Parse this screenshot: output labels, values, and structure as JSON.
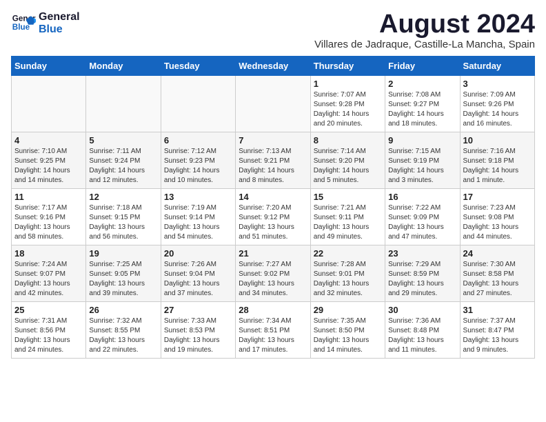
{
  "logo": {
    "line1": "General",
    "line2": "Blue"
  },
  "title": "August 2024",
  "location": "Villares de Jadraque, Castille-La Mancha, Spain",
  "weekdays": [
    "Sunday",
    "Monday",
    "Tuesday",
    "Wednesday",
    "Thursday",
    "Friday",
    "Saturday"
  ],
  "weeks": [
    [
      {
        "day": "",
        "info": ""
      },
      {
        "day": "",
        "info": ""
      },
      {
        "day": "",
        "info": ""
      },
      {
        "day": "",
        "info": ""
      },
      {
        "day": "1",
        "info": "Sunrise: 7:07 AM\nSunset: 9:28 PM\nDaylight: 14 hours\nand 20 minutes."
      },
      {
        "day": "2",
        "info": "Sunrise: 7:08 AM\nSunset: 9:27 PM\nDaylight: 14 hours\nand 18 minutes."
      },
      {
        "day": "3",
        "info": "Sunrise: 7:09 AM\nSunset: 9:26 PM\nDaylight: 14 hours\nand 16 minutes."
      }
    ],
    [
      {
        "day": "4",
        "info": "Sunrise: 7:10 AM\nSunset: 9:25 PM\nDaylight: 14 hours\nand 14 minutes."
      },
      {
        "day": "5",
        "info": "Sunrise: 7:11 AM\nSunset: 9:24 PM\nDaylight: 14 hours\nand 12 minutes."
      },
      {
        "day": "6",
        "info": "Sunrise: 7:12 AM\nSunset: 9:23 PM\nDaylight: 14 hours\nand 10 minutes."
      },
      {
        "day": "7",
        "info": "Sunrise: 7:13 AM\nSunset: 9:21 PM\nDaylight: 14 hours\nand 8 minutes."
      },
      {
        "day": "8",
        "info": "Sunrise: 7:14 AM\nSunset: 9:20 PM\nDaylight: 14 hours\nand 5 minutes."
      },
      {
        "day": "9",
        "info": "Sunrise: 7:15 AM\nSunset: 9:19 PM\nDaylight: 14 hours\nand 3 minutes."
      },
      {
        "day": "10",
        "info": "Sunrise: 7:16 AM\nSunset: 9:18 PM\nDaylight: 14 hours\nand 1 minute."
      }
    ],
    [
      {
        "day": "11",
        "info": "Sunrise: 7:17 AM\nSunset: 9:16 PM\nDaylight: 13 hours\nand 58 minutes."
      },
      {
        "day": "12",
        "info": "Sunrise: 7:18 AM\nSunset: 9:15 PM\nDaylight: 13 hours\nand 56 minutes."
      },
      {
        "day": "13",
        "info": "Sunrise: 7:19 AM\nSunset: 9:14 PM\nDaylight: 13 hours\nand 54 minutes."
      },
      {
        "day": "14",
        "info": "Sunrise: 7:20 AM\nSunset: 9:12 PM\nDaylight: 13 hours\nand 51 minutes."
      },
      {
        "day": "15",
        "info": "Sunrise: 7:21 AM\nSunset: 9:11 PM\nDaylight: 13 hours\nand 49 minutes."
      },
      {
        "day": "16",
        "info": "Sunrise: 7:22 AM\nSunset: 9:09 PM\nDaylight: 13 hours\nand 47 minutes."
      },
      {
        "day": "17",
        "info": "Sunrise: 7:23 AM\nSunset: 9:08 PM\nDaylight: 13 hours\nand 44 minutes."
      }
    ],
    [
      {
        "day": "18",
        "info": "Sunrise: 7:24 AM\nSunset: 9:07 PM\nDaylight: 13 hours\nand 42 minutes."
      },
      {
        "day": "19",
        "info": "Sunrise: 7:25 AM\nSunset: 9:05 PM\nDaylight: 13 hours\nand 39 minutes."
      },
      {
        "day": "20",
        "info": "Sunrise: 7:26 AM\nSunset: 9:04 PM\nDaylight: 13 hours\nand 37 minutes."
      },
      {
        "day": "21",
        "info": "Sunrise: 7:27 AM\nSunset: 9:02 PM\nDaylight: 13 hours\nand 34 minutes."
      },
      {
        "day": "22",
        "info": "Sunrise: 7:28 AM\nSunset: 9:01 PM\nDaylight: 13 hours\nand 32 minutes."
      },
      {
        "day": "23",
        "info": "Sunrise: 7:29 AM\nSunset: 8:59 PM\nDaylight: 13 hours\nand 29 minutes."
      },
      {
        "day": "24",
        "info": "Sunrise: 7:30 AM\nSunset: 8:58 PM\nDaylight: 13 hours\nand 27 minutes."
      }
    ],
    [
      {
        "day": "25",
        "info": "Sunrise: 7:31 AM\nSunset: 8:56 PM\nDaylight: 13 hours\nand 24 minutes."
      },
      {
        "day": "26",
        "info": "Sunrise: 7:32 AM\nSunset: 8:55 PM\nDaylight: 13 hours\nand 22 minutes."
      },
      {
        "day": "27",
        "info": "Sunrise: 7:33 AM\nSunset: 8:53 PM\nDaylight: 13 hours\nand 19 minutes."
      },
      {
        "day": "28",
        "info": "Sunrise: 7:34 AM\nSunset: 8:51 PM\nDaylight: 13 hours\nand 17 minutes."
      },
      {
        "day": "29",
        "info": "Sunrise: 7:35 AM\nSunset: 8:50 PM\nDaylight: 13 hours\nand 14 minutes."
      },
      {
        "day": "30",
        "info": "Sunrise: 7:36 AM\nSunset: 8:48 PM\nDaylight: 13 hours\nand 11 minutes."
      },
      {
        "day": "31",
        "info": "Sunrise: 7:37 AM\nSunset: 8:47 PM\nDaylight: 13 hours\nand 9 minutes."
      }
    ]
  ]
}
